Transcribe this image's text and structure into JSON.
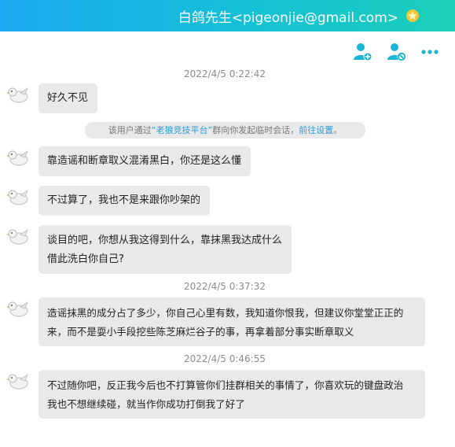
{
  "header": {
    "title": "白鸽先生<pigeonjie@gmail.com>",
    "badge_icon": "gold-star-badge-icon"
  },
  "toolbar": {
    "icons": [
      "add-contact-icon",
      "block-contact-icon",
      "more-options-icon"
    ],
    "accent": "#19b4d6"
  },
  "system_note": {
    "prefix": "该用户通过",
    "group": "“老狼竞技平台”",
    "middle": "群向你发起临时会话，",
    "link": "前往设置",
    "suffix": "。"
  },
  "timestamps": [
    "2022/4/5 0:22:42",
    "2022/4/5 0:37:32",
    "2022/4/5 0:46:55"
  ],
  "messages": [
    {
      "lines": [
        "好久不见"
      ]
    },
    {
      "lines": [
        "靠造谣和断章取义混淆黑白，你还是这么懂"
      ]
    },
    {
      "lines": [
        "不过算了，我也不是来跟你吵架的"
      ]
    },
    {
      "lines": [
        "谈目的吧，你想从我这得到什么，靠抹黑我达成什么",
        "借此洗白你自己?"
      ]
    },
    {
      "lines": [
        "造谣抹黑的成分占了多少，你自己心里有数，我知道你恨我，但建议你堂堂正正的",
        "来，而不是耍小手段挖些陈芝麻烂谷子的事，再拿着部分事实断章取义"
      ]
    },
    {
      "lines": [
        "不过随你吧，反正我今后也不打算管你们挂群相关的事情了，你喜欢玩的键盘政治",
        "我也不想继续碰，就当作你成功打倒我了好了"
      ]
    }
  ],
  "colors": {
    "title_gradient_start": "#1ba8f2",
    "title_gradient_end": "#1ccfb8",
    "bubble_bg": "#e9e9e9",
    "link": "#2a9bd8",
    "timestamp_text": "#8c8c8c"
  }
}
